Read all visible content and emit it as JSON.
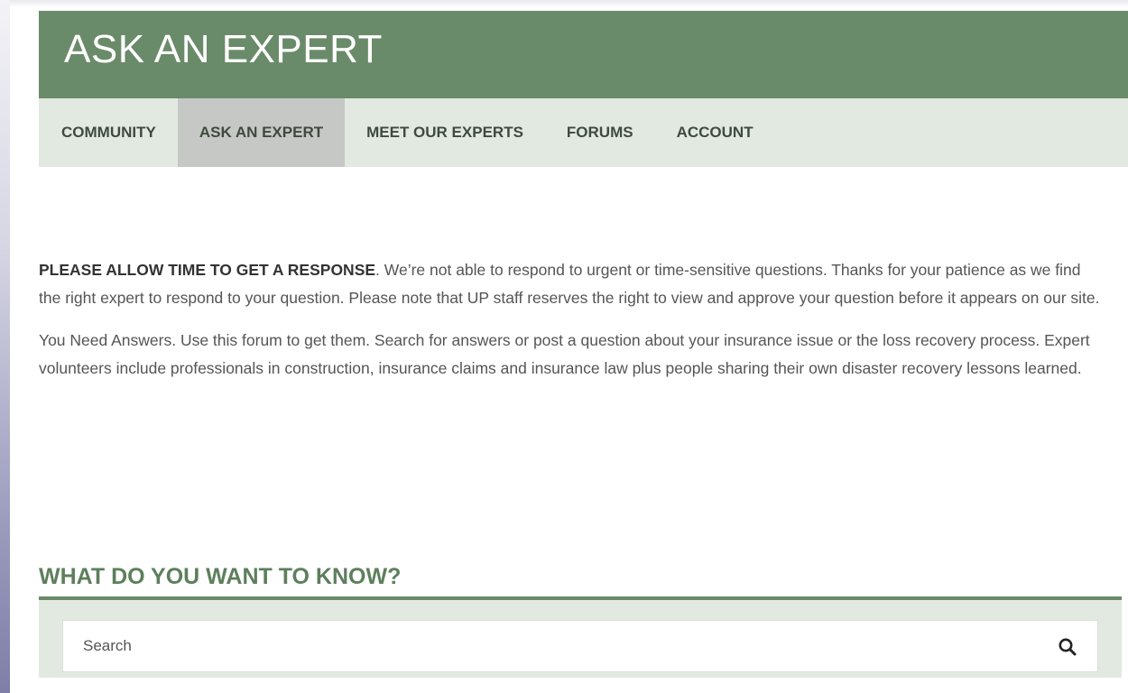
{
  "header": {
    "title": "ASK AN EXPERT"
  },
  "nav": {
    "items": [
      {
        "label": "COMMUNITY",
        "active": false
      },
      {
        "label": "ASK AN EXPERT",
        "active": true
      },
      {
        "label": "MEET OUR EXPERTS",
        "active": false
      },
      {
        "label": "FORUMS",
        "active": false
      },
      {
        "label": "ACCOUNT",
        "active": false
      }
    ]
  },
  "intro": {
    "lead": "PLEASE ALLOW TIME TO GET A RESPONSE",
    "lead_rest": ". We’re not able to respond to urgent or time-sensitive questions. Thanks for your patience as we find the right expert to respond to your question. Please note that UP staff reserves the right to view and approve your question before it appears on our site.",
    "paragraph2": "You Need Answers. Use this forum to get them. Search for answers or post a question about your insurance issue or the loss recovery process. Expert volunteers include professionals in construction, insurance claims and insurance law plus people sharing their own disaster recovery lessons learned."
  },
  "search_section": {
    "heading": "WHAT DO YOU WANT TO KNOW?",
    "placeholder": "Search",
    "value": "",
    "icon": "search-icon"
  },
  "colors": {
    "brand_green": "#6a8b69",
    "nav_background": "#e2e9e1",
    "nav_active": "#c5c8c5",
    "heading_green": "#5d7f5c"
  }
}
